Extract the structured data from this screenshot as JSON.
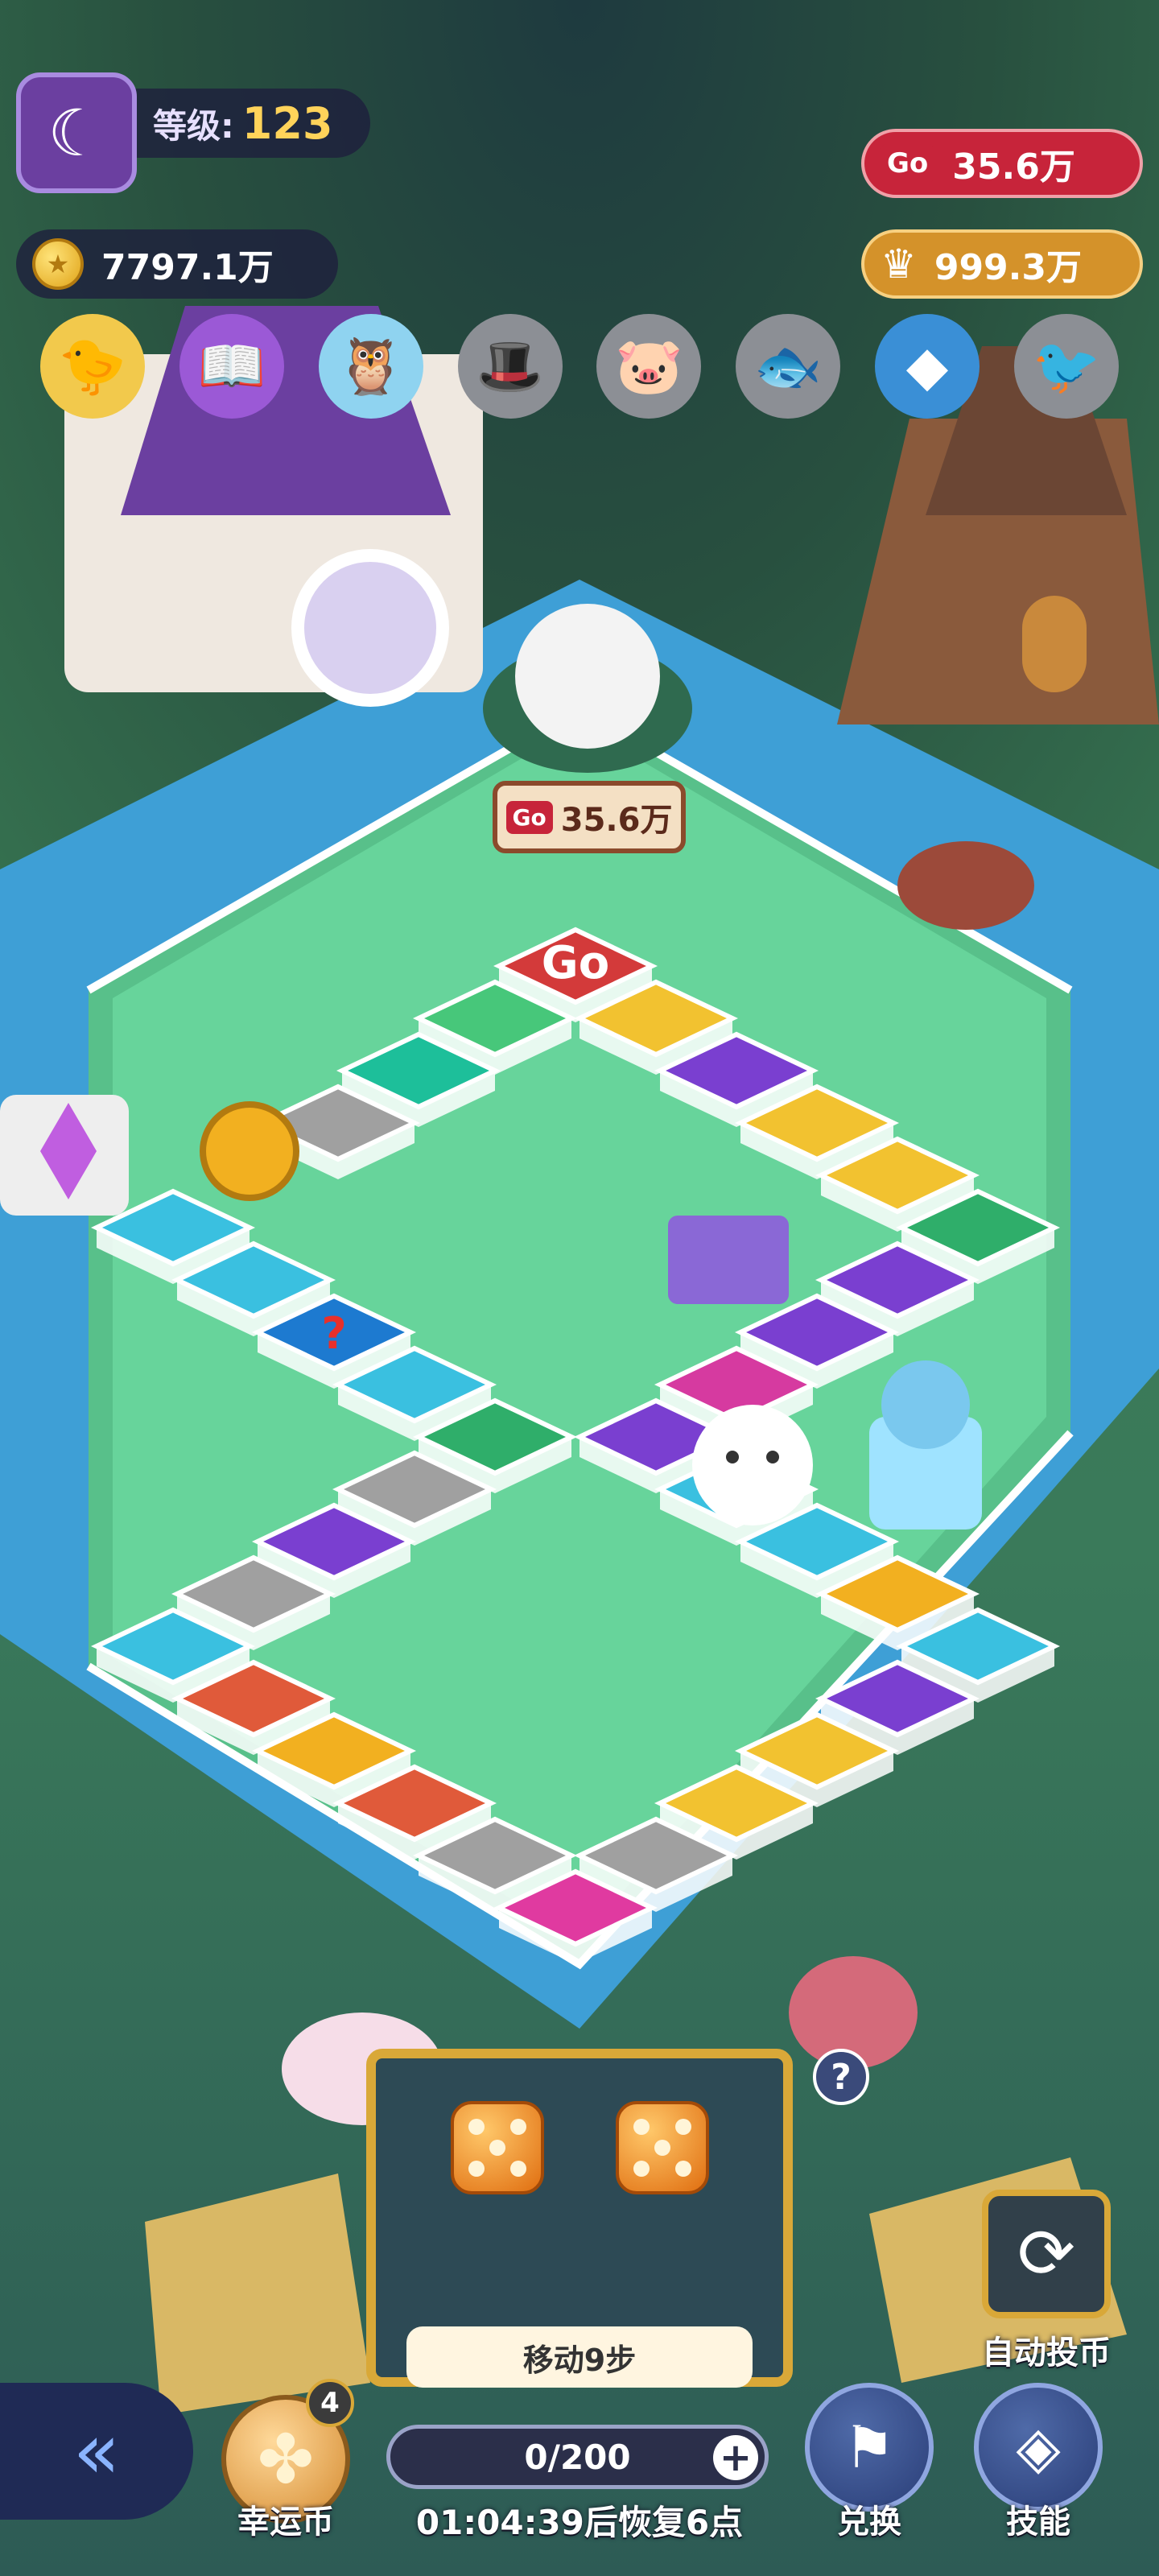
{
  "player": {
    "level_label": "等级:",
    "level_value": "123",
    "avatar_icon": "moon-face-icon"
  },
  "currency": {
    "gold": "7797.1万",
    "go_tokens": "35.6万",
    "gems": "999.3万",
    "go_badge": "Go"
  },
  "collection_icons": [
    "chick-icon",
    "book-icon",
    "owl-icon",
    "hat-icon",
    "pig-icon",
    "fish-icon",
    "diamond-icon",
    "bird-icon"
  ],
  "board": {
    "start_tile_label": "Go",
    "sign_value": "35.6万",
    "mystery_tile": "?"
  },
  "dice": {
    "values": [
      5,
      5
    ],
    "move_label": "移动9步"
  },
  "energy": {
    "value": "0/200",
    "timer": "01:04:39后恢复6点"
  },
  "buttons": {
    "lucky_coin": "幸运币",
    "lucky_badge": "4",
    "exchange": "兑换",
    "skills": "技能",
    "auto_roll": "自动投币",
    "help": "?"
  },
  "colors": {
    "accent_red": "#c7243a",
    "gold": "#d9a838",
    "panel": "#2d4a55",
    "river": "#3e9fd6"
  }
}
